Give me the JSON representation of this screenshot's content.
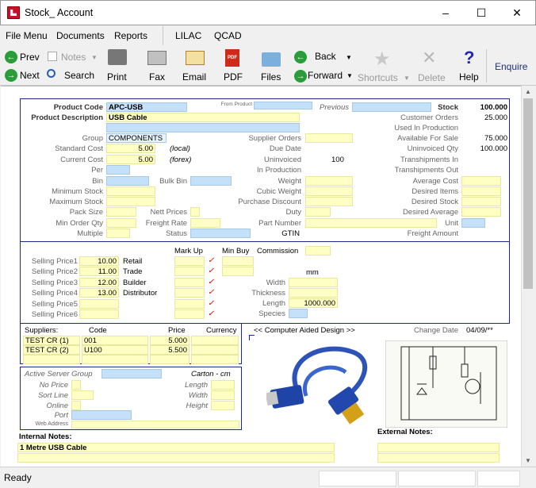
{
  "window": {
    "title": "Stock_ Account",
    "minimize": "–",
    "maximize": "☐",
    "close": "✕"
  },
  "menu": [
    "File Menu",
    "Documents",
    "Reports",
    "LILAC",
    "QCAD"
  ],
  "toolbar": {
    "prev": "Prev",
    "next": "Next",
    "notes": "Notes",
    "search": "Search",
    "print": "Print",
    "fax": "Fax",
    "email": "Email",
    "pdf": "PDF",
    "files": "Files",
    "back": "Back",
    "forward": "Forward",
    "shortcuts": "Shortcuts",
    "delete": "Delete",
    "help": "Help",
    "enquire": "Enquire",
    "help_glyph": "?",
    "pdf_glyph": "PDF",
    "prev_glyph": "←",
    "next_glyph": "→",
    "back_glyph": "←",
    "forward_glyph": "→",
    "delete_glyph": "✕",
    "star_glyph": "★",
    "dropdown_glyph": "▼"
  },
  "product": {
    "code_label": "Product Code",
    "code": "APC-USB",
    "from_product_label": "From Product",
    "previous_label": "Previous",
    "desc_label": "Product Description",
    "desc": "USB Cable",
    "group_label": "Group",
    "group": "COMPONENTS",
    "std_cost_label": "Standard Cost",
    "std_cost": "5.00",
    "std_note": "(local)",
    "cur_cost_label": "Current Cost",
    "cur_cost": "5.00",
    "cur_note": "(forex)",
    "per_label": "Per",
    "bin_label": "Bin",
    "bulk_bin_label": "Bulk Bin",
    "min_stock_label": "Minimum Stock",
    "max_stock_label": "Maximum Stock",
    "pack_size_label": "Pack Size",
    "nett_prices_label": "Nett Prices",
    "min_order_label": "Min Order Qty",
    "freight_rate_label": "Freight Rate",
    "multiple_label": "Multiple",
    "status_label": "Status",
    "supplier_orders_label": "Supplier Orders",
    "due_date_label": "Due Date",
    "uninvoiced_label": "Uninvoiced",
    "uninvoiced": "100",
    "in_production_label": "In Production",
    "weight_label": "Weight",
    "cubic_weight_label": "Cubic Weight",
    "purchase_discount_label": "Purchase Discount",
    "duty_label": "Duty",
    "part_number_label": "Part Number",
    "gtin_label": "GTIN",
    "stock_label": "Stock",
    "stock": "100.000",
    "customer_orders_label": "Customer Orders",
    "customer_orders": "25.000",
    "used_in_production_label": "Used In Production",
    "available_label": "Available For Sale",
    "available": "75.000",
    "uninvoiced_qty_label": "Uninvoiced Qty",
    "uninvoiced_qty": "100.000",
    "transhipments_in_label": "Transhipments In",
    "transhipments_out_label": "Transhipments Out",
    "avg_cost_label": "Average Cost",
    "desired_items_label": "Desired Items",
    "desired_stock_label": "Desired Stock",
    "desired_avg_label": "Desired Average",
    "unit_label": "Unit",
    "freight_amount_label": "Freight Amount"
  },
  "pricing": {
    "markup_label": "Mark Up",
    "min_buy_label": "Min Buy",
    "commission_label": "Commission",
    "rows": [
      {
        "label": "Selling Price1",
        "value": "10.00",
        "name": "Retail"
      },
      {
        "label": "Selling Price2",
        "value": "11.00",
        "name": "Trade"
      },
      {
        "label": "Selling Price3",
        "value": "12.00",
        "name": "Builder"
      },
      {
        "label": "Selling Price4",
        "value": "13.00",
        "name": "Distributor"
      },
      {
        "label": "Selling Price5",
        "value": "",
        "name": ""
      },
      {
        "label": "Selling Price6",
        "value": "",
        "name": ""
      }
    ],
    "tick": "✓",
    "mm_label": "mm",
    "width_label": "Width",
    "thickness_label": "Thickness",
    "length_label": "Length",
    "length": "1000.000",
    "species_label": "Species"
  },
  "suppliers": {
    "headers": [
      "Suppliers:",
      "Code",
      "Price",
      "Currency"
    ],
    "rows": [
      {
        "name": "TEST CR (1)",
        "code": "001",
        "price": "5.000"
      },
      {
        "name": "TEST CR (2)",
        "code": "U100",
        "price": "5.500"
      }
    ]
  },
  "cad": {
    "label": "<< Computer Aided Design >>",
    "change_date_label": "Change Date",
    "change_date": "04/09/**"
  },
  "web": {
    "active_server_label": "Active Server Group",
    "no_price_label": "No Price",
    "sort_line_label": "Sort Line",
    "online_label": "Online",
    "port_label": "Port",
    "web_address_label": "Web Address",
    "carton_label": "Carton - cm",
    "length_label": "Length",
    "width_label": "Width",
    "height_label": "Height"
  },
  "notes": {
    "internal_label": "Internal Notes:",
    "internal": "1 Metre USB Cable",
    "external_label": "External Notes:"
  },
  "status_text": "Ready"
}
